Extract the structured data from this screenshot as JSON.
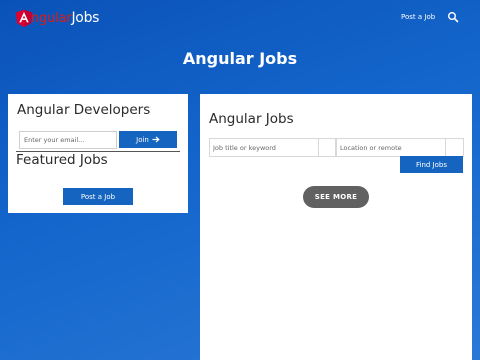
{
  "header": {
    "logo_letter": "A",
    "logo_text_angular": "ngular",
    "logo_text_jobs": "Jobs",
    "nav_post_label": "Post a Job",
    "search_icon": "search-icon"
  },
  "hero": {
    "title": "Angular Jobs"
  },
  "left_card": {
    "title": "Angular Developers",
    "email_placeholder": "Enter your email...",
    "join_label": "Join",
    "join_icon": "arrow-right-icon",
    "featured_title": "Featured Jobs",
    "post_job_label": "Post a Job"
  },
  "right_card": {
    "title": "Angular Jobs",
    "keyword_placeholder": "Job title or keyword",
    "location_placeholder": "Location or remote",
    "find_label": "Find Jobs",
    "see_more_label": "SEE MORE"
  },
  "colors": {
    "brand_red": "#dd1b16",
    "button_blue": "#1565c0",
    "see_more_grey": "#616161",
    "background_blue": "#1466cc"
  }
}
